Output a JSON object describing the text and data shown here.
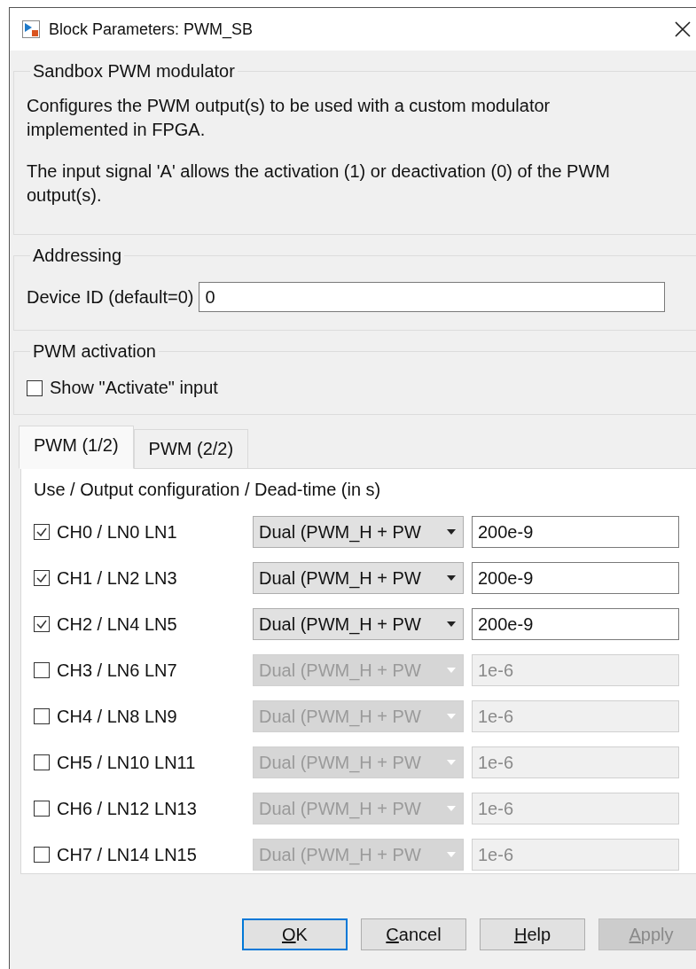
{
  "window": {
    "title": "Block Parameters: PWM_SB"
  },
  "description": {
    "title": "Sandbox PWM modulator",
    "paragraphs": [
      "Configures the PWM output(s) to be used with a custom modulator implemented in FPGA.",
      "The input signal 'A' allows the activation (1) or deactivation (0) of the PWM output(s)."
    ]
  },
  "addressing": {
    "title": "Addressing",
    "label": "Device ID (default=0)",
    "value": "0"
  },
  "activation": {
    "title": "PWM activation",
    "label": "Show \"Activate\" input",
    "checked": false
  },
  "tabs": [
    {
      "label": "PWM (1/2)",
      "selected": true
    },
    {
      "label": "PWM (2/2)",
      "selected": false
    }
  ],
  "channels_header": "Use / Output configuration / Dead-time (in s)",
  "channels": [
    {
      "label": "CH0 / LN0 LN1",
      "checked": true,
      "config": "Dual (PWM_H + PW",
      "dead_time": "200e-9"
    },
    {
      "label": "CH1 / LN2 LN3",
      "checked": true,
      "config": "Dual (PWM_H + PW",
      "dead_time": "200e-9"
    },
    {
      "label": "CH2 / LN4 LN5",
      "checked": true,
      "config": "Dual (PWM_H + PW",
      "dead_time": "200e-9"
    },
    {
      "label": "CH3 / LN6 LN7",
      "checked": false,
      "config": "Dual (PWM_H + PW",
      "dead_time": "1e-6"
    },
    {
      "label": "CH4 / LN8 LN9",
      "checked": false,
      "config": "Dual (PWM_H + PW",
      "dead_time": "1e-6"
    },
    {
      "label": "CH5 / LN10 LN11",
      "checked": false,
      "config": "Dual (PWM_H + PW",
      "dead_time": "1e-6"
    },
    {
      "label": "CH6 / LN12 LN13",
      "checked": false,
      "config": "Dual (PWM_H + PW",
      "dead_time": "1e-6"
    },
    {
      "label": "CH7 / LN14 LN15",
      "checked": false,
      "config": "Dual (PWM_H + PW",
      "dead_time": "1e-6"
    }
  ],
  "buttons": [
    {
      "label": "OK",
      "default": true,
      "disabled": false,
      "mnemonic": true
    },
    {
      "label": "Cancel",
      "default": false,
      "disabled": false,
      "mnemonic": true
    },
    {
      "label": "Help",
      "default": false,
      "disabled": false,
      "mnemonic": true
    },
    {
      "label": "Apply",
      "default": false,
      "disabled": true,
      "mnemonic": true
    }
  ]
}
